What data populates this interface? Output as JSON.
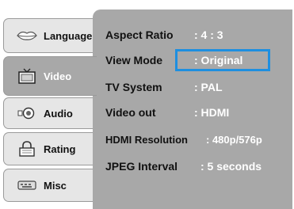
{
  "sidebar": {
    "tabs": [
      {
        "label": "Language",
        "icon": "lips-icon"
      },
      {
        "label": "Video",
        "icon": "tv-icon",
        "active": true
      },
      {
        "label": "Audio",
        "icon": "speaker-icon"
      },
      {
        "label": "Rating",
        "icon": "padlock-icon"
      },
      {
        "label": "Misc",
        "icon": "keyboard-icon"
      }
    ]
  },
  "settings": [
    {
      "key": "Aspect Ratio",
      "value": ": 4 : 3"
    },
    {
      "key": "View Mode",
      "value": ": Original",
      "selected": true
    },
    {
      "key": "TV System",
      "value": ": PAL"
    },
    {
      "key": "Video out",
      "value": ": HDMI"
    },
    {
      "key": "HDMI Resolution",
      "value": ": 480p/576p"
    },
    {
      "key": "JPEG Interval",
      "value": ": 5 seconds"
    }
  ],
  "colors": {
    "panel": "#a8a8a8",
    "tab": "#e6e6e6",
    "highlight": "#1e8fe0",
    "value_text": "#ffffff"
  }
}
